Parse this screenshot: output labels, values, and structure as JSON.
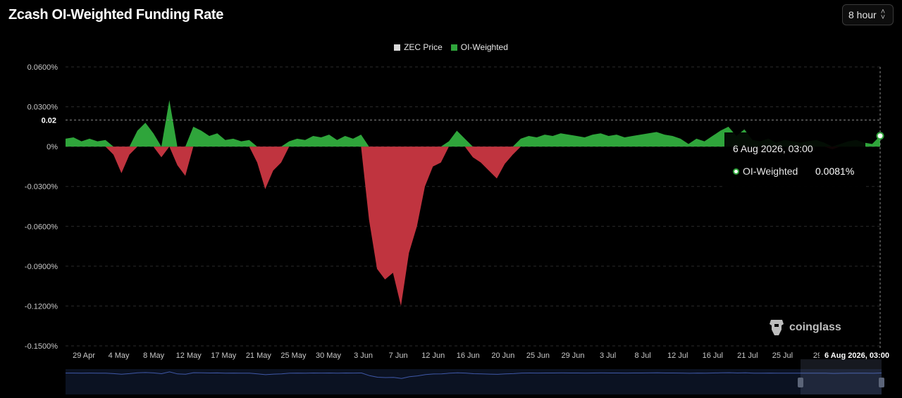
{
  "header": {
    "title": "Zcash OI-Weighted Funding Rate",
    "interval_label": "8 hour"
  },
  "legend": [
    {
      "name": "ZEC Price",
      "color": "#d9d9d9"
    },
    {
      "name": "OI-Weighted",
      "color": "#2fa53b"
    }
  ],
  "crosshair": {
    "y_label": "0.02",
    "x_label": "6 Aug 2026, 03:00"
  },
  "tooltip": {
    "date": "6 Aug 2026, 03:00",
    "series_name": "OI-Weighted",
    "value": "0.0081%"
  },
  "watermark": {
    "text": "coinglass"
  },
  "colors": {
    "positive": "#2fa53b",
    "negative": "#c0343f",
    "background": "#000000"
  },
  "chart_data": {
    "type": "area",
    "title": "Zcash OI-Weighted Funding Rate",
    "unit": "%",
    "ylim": [
      -0.15,
      0.06
    ],
    "y_ticks": [
      "0.0600%",
      "0.0300%",
      "0%",
      "-0.0300%",
      "-0.0600%",
      "-0.0900%",
      "-0.1200%",
      "-0.1500%"
    ],
    "x_ticks": [
      "29 Apr",
      "4 May",
      "8 May",
      "12 May",
      "17 May",
      "21 May",
      "25 May",
      "30 May",
      "3 Jun",
      "7 Jun",
      "12 Jun",
      "16 Jun",
      "20 Jun",
      "25 Jun",
      "29 Jun",
      "3 Jul",
      "8 Jul",
      "12 Jul",
      "16 Jul",
      "21 Jul",
      "25 Jul",
      "29"
    ],
    "x_range": [
      "2026-04-26",
      "2026-08-06"
    ],
    "grid": true,
    "legend_position": "top-center",
    "series": [
      {
        "name": "OI-Weighted",
        "x": [
          "2026-04-26",
          "2026-04-27",
          "2026-04-28",
          "2026-04-29",
          "2026-04-30",
          "2026-05-01",
          "2026-05-02",
          "2026-05-03",
          "2026-05-04",
          "2026-05-05",
          "2026-05-06",
          "2026-05-07",
          "2026-05-08",
          "2026-05-09",
          "2026-05-10",
          "2026-05-11",
          "2026-05-12",
          "2026-05-13",
          "2026-05-14",
          "2026-05-15",
          "2026-05-16",
          "2026-05-17",
          "2026-05-18",
          "2026-05-19",
          "2026-05-20",
          "2026-05-21",
          "2026-05-22",
          "2026-05-23",
          "2026-05-24",
          "2026-05-25",
          "2026-05-26",
          "2026-05-27",
          "2026-05-28",
          "2026-05-29",
          "2026-05-30",
          "2026-05-31",
          "2026-06-01",
          "2026-06-02",
          "2026-06-03",
          "2026-06-04",
          "2026-06-05",
          "2026-06-06",
          "2026-06-07",
          "2026-06-08",
          "2026-06-09",
          "2026-06-10",
          "2026-06-11",
          "2026-06-12",
          "2026-06-13",
          "2026-06-14",
          "2026-06-15",
          "2026-06-16",
          "2026-06-17",
          "2026-06-18",
          "2026-06-19",
          "2026-06-20",
          "2026-06-21",
          "2026-06-22",
          "2026-06-23",
          "2026-06-24",
          "2026-06-25",
          "2026-06-26",
          "2026-06-27",
          "2026-06-28",
          "2026-06-29",
          "2026-06-30",
          "2026-07-01",
          "2026-07-02",
          "2026-07-03",
          "2026-07-04",
          "2026-07-05",
          "2026-07-06",
          "2026-07-07",
          "2026-07-08",
          "2026-07-09",
          "2026-07-10",
          "2026-07-11",
          "2026-07-12",
          "2026-07-13",
          "2026-07-14",
          "2026-07-15",
          "2026-07-16",
          "2026-07-17",
          "2026-07-18",
          "2026-07-19",
          "2026-07-20",
          "2026-07-21",
          "2026-07-22",
          "2026-07-23",
          "2026-07-24",
          "2026-07-25",
          "2026-07-26",
          "2026-07-27",
          "2026-07-28",
          "2026-07-29",
          "2026-07-30",
          "2026-07-31",
          "2026-08-01",
          "2026-08-02",
          "2026-08-03",
          "2026-08-04",
          "2026-08-05",
          "2026-08-06"
        ],
        "values": [
          0.006,
          0.007,
          0.004,
          0.006,
          0.004,
          0.005,
          -0.006,
          -0.02,
          -0.006,
          0.012,
          0.018,
          0.01,
          -0.008,
          0.035,
          -0.014,
          -0.022,
          0.015,
          0.012,
          0.008,
          0.01,
          0.005,
          0.006,
          0.004,
          0.005,
          -0.012,
          -0.032,
          -0.018,
          -0.012,
          0.004,
          0.006,
          0.005,
          0.008,
          0.007,
          0.009,
          0.005,
          0.008,
          0.006,
          0.009,
          -0.055,
          -0.092,
          -0.1,
          -0.095,
          -0.12,
          -0.08,
          -0.06,
          -0.03,
          -0.015,
          -0.012,
          0.004,
          0.012,
          0.006,
          -0.008,
          -0.012,
          -0.018,
          -0.024,
          -0.013,
          -0.006,
          0.006,
          0.008,
          0.007,
          0.009,
          0.008,
          0.01,
          0.009,
          0.008,
          0.007,
          0.009,
          0.01,
          0.008,
          0.009,
          0.007,
          0.008,
          0.009,
          0.01,
          0.011,
          0.009,
          0.008,
          0.006,
          0.002,
          0.006,
          0.004,
          0.008,
          0.012,
          0.015,
          0.008,
          0.013,
          0.005,
          0.004,
          0.006,
          0.003,
          0.005,
          0.004,
          0.003,
          0.004,
          0.005,
          0.003,
          -0.002,
          0.002,
          0.004,
          0.005,
          0.003,
          0.002,
          0.0081
        ]
      }
    ]
  }
}
